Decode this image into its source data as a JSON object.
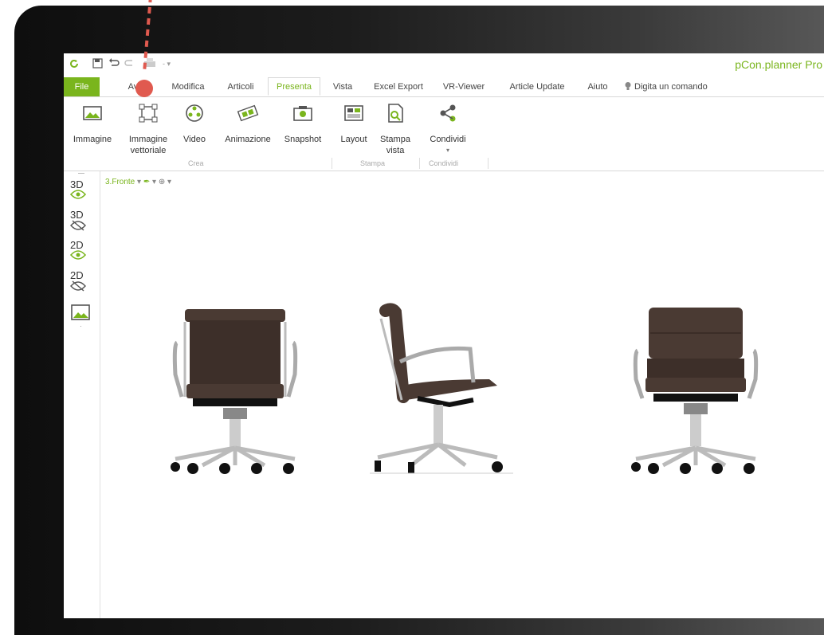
{
  "app": {
    "title": "pCon.planner Pro"
  },
  "qat": {
    "icons": [
      "refresh-icon",
      "save-icon",
      "undo-icon",
      "redo-icon",
      "print-icon",
      "dropdown-icon"
    ]
  },
  "menu": {
    "tabs": [
      "File",
      "Avvia",
      "Modifica",
      "Articoli",
      "Presenta",
      "Vista",
      "Excel Export",
      "VR-Viewer",
      "Article Update",
      "Aiuto"
    ],
    "active_tab": "Presenta",
    "search_label": "Digita un comando"
  },
  "ribbon": {
    "buttons": [
      {
        "line1": "Immagine",
        "line2": ""
      },
      {
        "line1": "Immagine",
        "line2": "vettoriale"
      },
      {
        "line1": "Video",
        "line2": ""
      },
      {
        "line1": "Animazione",
        "line2": ""
      },
      {
        "line1": "Snapshot",
        "line2": ""
      },
      {
        "line1": "Layout",
        "line2": ""
      },
      {
        "line1": "Stampa",
        "line2": "vista"
      },
      {
        "line1": "Condividi",
        "line2": ""
      }
    ],
    "groups": [
      "Crea",
      "Stampa",
      "Condividi"
    ]
  },
  "sidebar": {
    "modes": [
      "3D",
      "3D",
      "2D",
      "2D"
    ]
  },
  "canvas": {
    "view_label": "3.Fronte",
    "chairs": [
      "chair-front-view",
      "chair-side-view",
      "chair-front-view-alt"
    ]
  },
  "colors": {
    "accent": "#7ab51d",
    "marker": "#e05a4f",
    "chair": "#4a3a33"
  }
}
